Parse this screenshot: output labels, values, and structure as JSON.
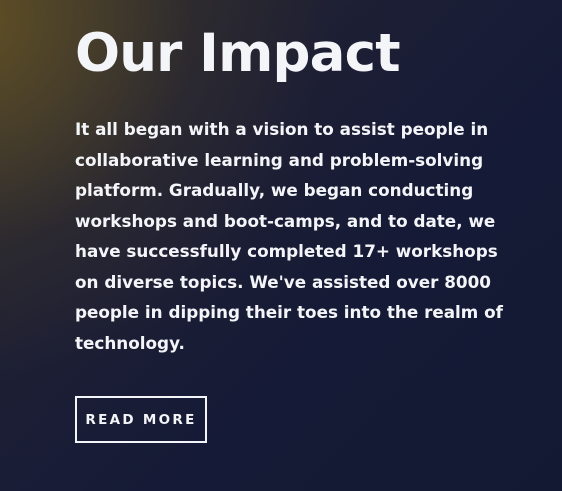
{
  "impact_section": {
    "title": "Our Impact",
    "description": "It all began with a vision to assist people in collaborative learning and problem-solving platform. Gradually, we began conducting workshops and boot-camps, and to date, we have successfully completed 17+ workshops on diverse topics. We've assisted over 8000 people in dipping their toes into the realm of technology.",
    "button_label": "READ MORE"
  },
  "colors": {
    "background_navy": "#151a36",
    "background_gold_glow": "#695623",
    "text": "#f4f5f8"
  }
}
